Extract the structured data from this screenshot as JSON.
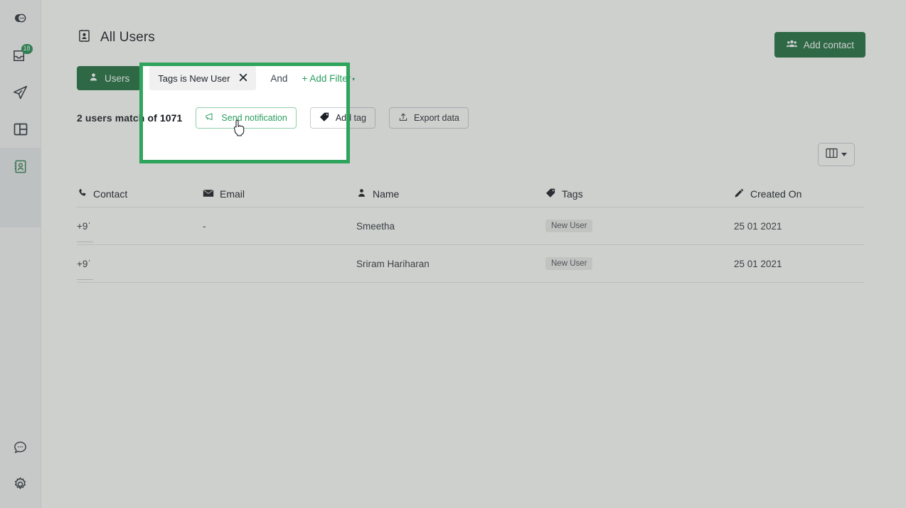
{
  "sidebar": {
    "items": [
      {
        "name": "chat-logo-icon",
        "label": "",
        "badge": null
      },
      {
        "name": "inbox-icon",
        "label": "",
        "badge": "18"
      },
      {
        "name": "send-icon",
        "label": "",
        "badge": null
      },
      {
        "name": "dashboard-icon",
        "label": "",
        "badge": null
      },
      {
        "name": "contacts-icon",
        "label": "",
        "badge": null
      }
    ],
    "bottom_items": [
      {
        "name": "help-chat-icon",
        "label": ""
      },
      {
        "name": "settings-gear-icon",
        "label": ""
      }
    ]
  },
  "header": {
    "title": "All Users",
    "title_icon": "contact-book-icon",
    "add_contact_label": "Add contact",
    "add_contact_icon": "people-icon"
  },
  "filters": {
    "users_tab_label": "Users",
    "users_tab_icon": "user-icon",
    "chip_label": "Tags is New User",
    "chip_close_icon": "close-icon",
    "conjunction_label": "And",
    "add_filter_label": "+ Add Filter"
  },
  "actions": {
    "match_text": "2 users match of 1071",
    "send_notification_label": "Send notification",
    "send_notification_icon": "megaphone-icon",
    "add_tag_label": "Add tag",
    "add_tag_icon": "tag-icon",
    "export_data_label": "Export data",
    "export_data_icon": "export-icon"
  },
  "toolbar": {
    "columns_icon": "columns-icon",
    "columns_caret_icon": "chevron-down-icon"
  },
  "table": {
    "columns": [
      {
        "label": "Contact",
        "icon": "phone-icon"
      },
      {
        "label": "Email",
        "icon": "envelope-icon"
      },
      {
        "label": "Name",
        "icon": "user-icon"
      },
      {
        "label": "Tags",
        "icon": "tag-icon"
      },
      {
        "label": "Created On",
        "icon": "pencil-icon"
      }
    ],
    "rows": [
      {
        "contact": "+9ˈ",
        "email": "-",
        "name": "Smeetha",
        "tag": "New User",
        "created_on": "25 01 2021"
      },
      {
        "contact": "+9ˈ",
        "email": "",
        "name": "Sriram Hariharan",
        "tag": "New User",
        "created_on": "25 01 2021"
      }
    ]
  },
  "colors": {
    "brand_green": "#1a6b3c",
    "accent_green": "#2a9e5e",
    "highlight_green": "#2fa45c",
    "badge_green": "#1d8a4e"
  }
}
